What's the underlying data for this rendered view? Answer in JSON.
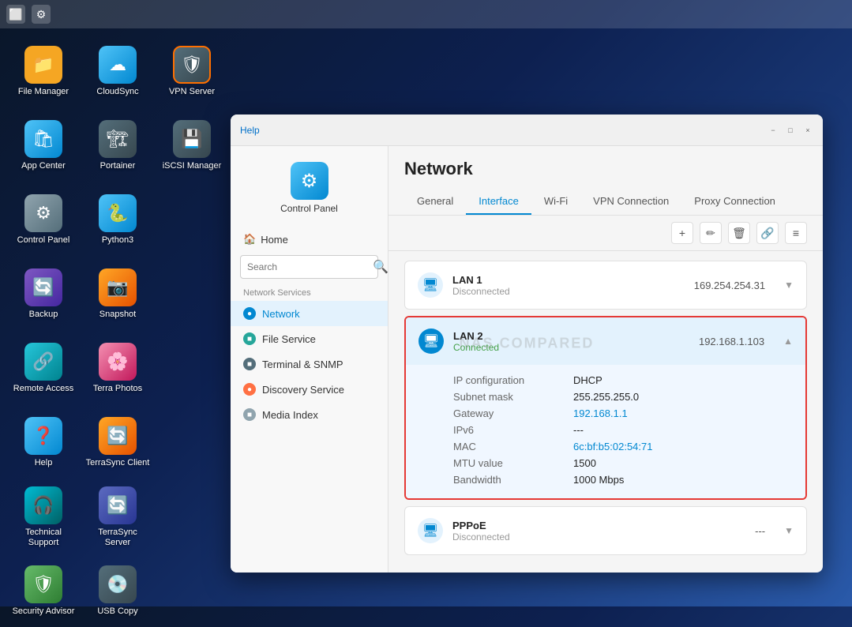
{
  "taskbar": {
    "icons": [
      {
        "name": "window-icon",
        "symbol": "⬜"
      },
      {
        "name": "settings-icon",
        "symbol": "⚙"
      }
    ]
  },
  "desktop": {
    "icons": [
      {
        "id": "file-manager",
        "label": "File Manager",
        "symbol": "📁",
        "color": "ic-yellow"
      },
      {
        "id": "cloudsync",
        "label": "CloudSync",
        "symbol": "☁",
        "color": "ic-blue"
      },
      {
        "id": "vpn-server",
        "label": "VPN Server",
        "symbol": "🛡",
        "color": "ic-shield"
      },
      {
        "id": "app-center",
        "label": "App Center",
        "symbol": "🛍",
        "color": "ic-blue"
      },
      {
        "id": "portainer",
        "label": "Portainer",
        "symbol": "🏗",
        "color": "ic-dark"
      },
      {
        "id": "iscsi-manager",
        "label": "iSCSI Manager",
        "symbol": "💾",
        "color": "ic-dark"
      },
      {
        "id": "control-panel",
        "label": "Control Panel",
        "symbol": "⚙",
        "color": "ic-gray"
      },
      {
        "id": "python3",
        "label": "Python3",
        "symbol": "🐍",
        "color": "ic-blue"
      },
      {
        "id": "spacer1",
        "label": "",
        "symbol": "",
        "color": ""
      },
      {
        "id": "backup",
        "label": "Backup",
        "symbol": "🔄",
        "color": "ic-purple"
      },
      {
        "id": "snapshot",
        "label": "Snapshot",
        "symbol": "📷",
        "color": "ic-orange"
      },
      {
        "id": "spacer2",
        "label": "",
        "symbol": "",
        "color": ""
      },
      {
        "id": "remote-access",
        "label": "Remote Access",
        "symbol": "🔗",
        "color": "ic-teal"
      },
      {
        "id": "terra-photos",
        "label": "Terra Photos",
        "symbol": "🌸",
        "color": "ic-pink"
      },
      {
        "id": "spacer3",
        "label": "",
        "symbol": "",
        "color": ""
      },
      {
        "id": "help",
        "label": "Help",
        "symbol": "❓",
        "color": "ic-blue"
      },
      {
        "id": "terrasync-client",
        "label": "TerraSync Client",
        "symbol": "🔄",
        "color": "ic-orange"
      },
      {
        "id": "spacer4",
        "label": "",
        "symbol": "",
        "color": ""
      },
      {
        "id": "technical-support",
        "label": "Technical Support",
        "symbol": "🎧",
        "color": "ic-cyan"
      },
      {
        "id": "terrasync-server",
        "label": "TerraSync Server",
        "symbol": "🔄",
        "color": "ic-indigo"
      },
      {
        "id": "spacer5",
        "label": "",
        "symbol": "",
        "color": ""
      },
      {
        "id": "security-advisor",
        "label": "Security Advisor",
        "symbol": "🛡",
        "color": "ic-green"
      },
      {
        "id": "usb-copy",
        "label": "USB Copy",
        "symbol": "💿",
        "color": "ic-dark"
      }
    ]
  },
  "window": {
    "help_label": "Help",
    "min_symbol": "−",
    "max_symbol": "□",
    "close_symbol": "×",
    "control_panel_label": "Control Panel",
    "nav": {
      "home_label": "Home",
      "search_placeholder": "Search",
      "section_label": "Network Services",
      "items": [
        {
          "id": "network",
          "label": "Network",
          "color": "nav-dot-blue"
        },
        {
          "id": "file-service",
          "label": "File Service",
          "color": "nav-dot-teal"
        },
        {
          "id": "terminal-snmp",
          "label": "Terminal & SNMP",
          "color": "nav-dot-dark"
        },
        {
          "id": "discovery-service",
          "label": "Discovery Service",
          "color": "nav-dot-orange"
        },
        {
          "id": "media-index",
          "label": "Media Index",
          "color": "nav-dot-gray"
        }
      ]
    },
    "content": {
      "title": "Network",
      "tabs": [
        {
          "id": "general",
          "label": "General"
        },
        {
          "id": "interface",
          "label": "Interface"
        },
        {
          "id": "wifi",
          "label": "Wi-Fi"
        },
        {
          "id": "vpn-connection",
          "label": "VPN Connection"
        },
        {
          "id": "proxy-connection",
          "label": "Proxy Connection"
        }
      ],
      "active_tab": "interface",
      "toolbar": {
        "add_symbol": "+",
        "edit_symbol": "✏",
        "delete_symbol": "🗑",
        "link_symbol": "🔗",
        "menu_symbol": "≡"
      },
      "networks": [
        {
          "id": "lan1",
          "name": "LAN 1",
          "status": "Disconnected",
          "ip": "169.254.254.31",
          "expanded": false
        },
        {
          "id": "lan2",
          "name": "LAN 2",
          "status": "Connected",
          "ip": "192.168.1.103",
          "expanded": true,
          "details": {
            "ip_config_label": "IP configuration",
            "ip_config_value": "DHCP",
            "subnet_label": "Subnet mask",
            "subnet_value": "255.255.255.0",
            "gateway_label": "Gateway",
            "gateway_value": "192.168.1.1",
            "ipv6_label": "IPv6",
            "ipv6_value": "---",
            "mac_label": "MAC",
            "mac_value": "6c:bf:b5:02:54:71",
            "mtu_label": "MTU value",
            "mtu_value": "1500",
            "bandwidth_label": "Bandwidth",
            "bandwidth_value": "1000 Mbps"
          }
        },
        {
          "id": "pppoe",
          "name": "PPPoE",
          "status": "Disconnected",
          "ip": "---",
          "expanded": false
        }
      ],
      "watermark": "NAS COMPARED"
    }
  }
}
